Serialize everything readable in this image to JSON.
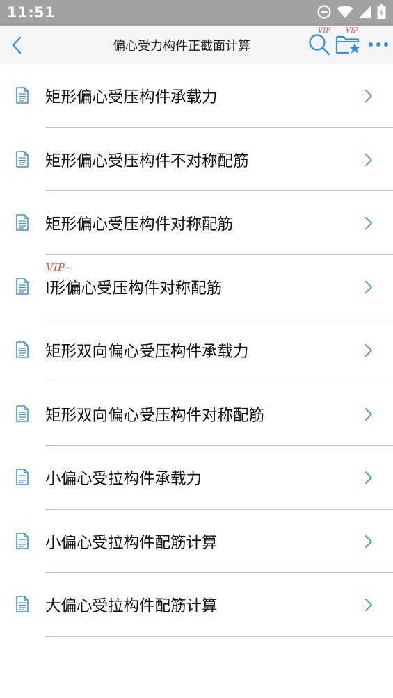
{
  "status_bar": {
    "time": "11:51",
    "icons": [
      "do-not-disturb-icon",
      "wifi-icon",
      "signal-icon",
      "battery-icon"
    ]
  },
  "nav": {
    "back_icon": "chevron-left-icon",
    "title": "偏心受力构件正截面计算",
    "search_vip": "VIP",
    "favorite_vip": "VIP",
    "icons": [
      "search-icon",
      "folder-star-icon",
      "more-icon"
    ]
  },
  "list": {
    "items": [
      {
        "label": "矩形偏心受压构件承载力",
        "vip": ""
      },
      {
        "label": "矩形偏心受压构件不对称配筋",
        "vip": ""
      },
      {
        "label": "矩形偏心受压构件对称配筋",
        "vip": ""
      },
      {
        "label": "I形偏心受压构件对称配筋",
        "vip": "VIP~"
      },
      {
        "label": "矩形双向偏心受压构件承载力",
        "vip": ""
      },
      {
        "label": "矩形双向偏心受压构件对称配筋",
        "vip": ""
      },
      {
        "label": "小偏心受拉构件承载力",
        "vip": ""
      },
      {
        "label": "小偏心受拉构件配筋计算",
        "vip": ""
      },
      {
        "label": "大偏心受拉构件配筋计算",
        "vip": ""
      }
    ],
    "item_icon": "document-icon",
    "chevron_icon": "chevron-right-icon"
  },
  "colors": {
    "accent": "#3d8fd6",
    "vip": "#d9534f",
    "status_bar": "#a2a2a2",
    "nav_bg": "#f4f5f7",
    "divider": "#c4c4c4"
  }
}
